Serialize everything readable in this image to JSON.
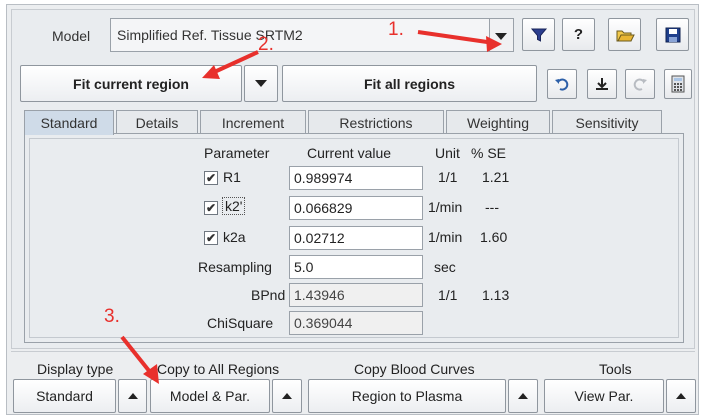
{
  "model": {
    "label": "Model",
    "value": "Simplified Ref. Tissue SRTM2"
  },
  "toolbar": {
    "filter_icon": "filter-icon",
    "help_label": "?",
    "open_icon": "folder-open-icon",
    "save_icon": "save-icon",
    "fit_current_label": "Fit current region",
    "fit_all_label": "Fit all regions",
    "undo_icon": "undo-icon",
    "download_icon": "download-icon",
    "redo_icon": "redo-icon",
    "calc_icon": "calculator-icon"
  },
  "tabs": [
    {
      "label": "Standard",
      "active": true
    },
    {
      "label": "Details"
    },
    {
      "label": "Increment"
    },
    {
      "label": "Restrictions"
    },
    {
      "label": "Weighting"
    },
    {
      "label": "Sensitivity"
    }
  ],
  "table": {
    "headers": {
      "parameter": "Parameter",
      "current": "Current value",
      "unit": "Unit",
      "se": "% SE"
    },
    "rows": [
      {
        "name": "R1",
        "checked": true,
        "value": "0.989974",
        "unit": "1/1",
        "se": "1.21"
      },
      {
        "name": "k2'",
        "checked": true,
        "value": "0.066829",
        "unit": "1/min",
        "se": "---"
      },
      {
        "name": "k2a",
        "checked": true,
        "value": "0.02712",
        "unit": "1/min",
        "se": "1.60"
      },
      {
        "name": "Resampling",
        "value": "5.0",
        "unit": "sec"
      },
      {
        "name": "BPnd",
        "value": "1.43946",
        "unit": "1/1",
        "se": "1.13"
      },
      {
        "name": "ChiSquare",
        "value": "0.369044"
      }
    ]
  },
  "bottom": {
    "display_type_label": "Display type",
    "display_type_value": "Standard",
    "copy_all_label": "Copy to All Regions",
    "copy_all_value": "Model & Par.",
    "copy_blood_label": "Copy Blood Curves",
    "copy_blood_value": "Region to Plasma",
    "tools_label": "Tools",
    "tools_value": "View Par."
  },
  "annotations": {
    "a1": "1.",
    "a2": "2.",
    "a3": "3."
  },
  "colors": {
    "annotation": "#e8302c",
    "active_tab": "#cfdbe8"
  }
}
